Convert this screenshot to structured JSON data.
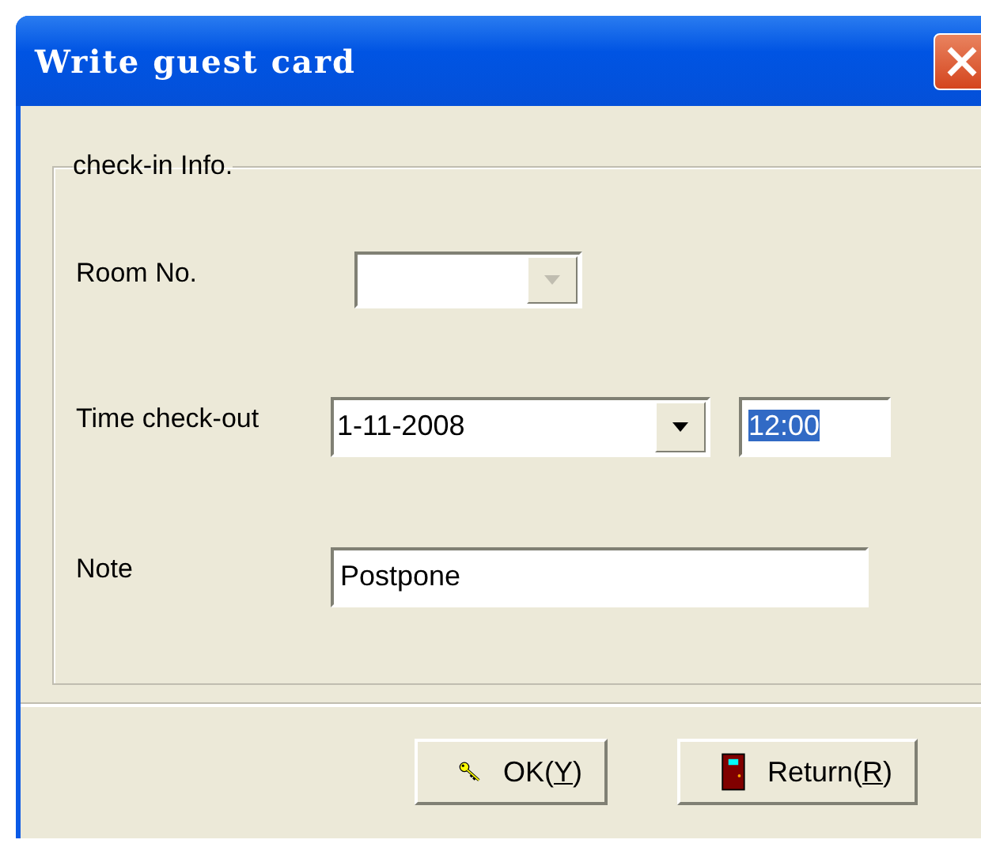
{
  "window": {
    "title": "Write guest card"
  },
  "group": {
    "title": "check-in Info."
  },
  "room": {
    "label": "Room No.",
    "disabled": true
  },
  "checkout": {
    "label": "Time check-out",
    "date": "1-11-2008",
    "time": "12:00",
    "time_selected": true
  },
  "note": {
    "label": "Note",
    "value": "Postpone"
  },
  "buttons": [
    {
      "kind": "key",
      "label": "OK(",
      "mnemonic": "Y",
      "suffix": ")"
    },
    {
      "kind": "door",
      "label": "Return(",
      "mnemonic": "R",
      "suffix": ")"
    }
  ]
}
